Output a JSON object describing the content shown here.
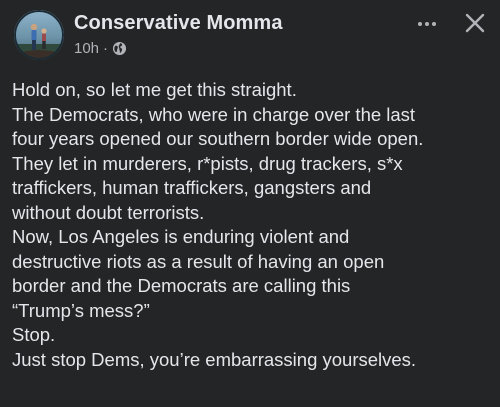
{
  "post": {
    "author": "Conservative Momma",
    "time": "10h",
    "separator": "·",
    "privacy_icon": "globe-icon",
    "more_icon": "more-horizontal-icon",
    "close_icon": "close-icon",
    "lines": [
      "Hold on, so let me get this straight.",
      "The Democrats, who were in charge over the last",
      "four years opened our southern border wide open.",
      "They let in murderers, r*pists, drug trackers, s*x",
      "traffickers, human traffickers, gangsters and",
      "without doubt terrorists.",
      "Now, Los Angeles is enduring violent and",
      "destructive riots as a result of having an open",
      "border and the Democrats are calling this",
      "“Trump’s mess?”",
      "Stop.",
      "Just stop Dems, you’re embarrassing yourselves."
    ]
  },
  "colors": {
    "background": "#242526",
    "primary_text": "#e4e6eb",
    "secondary_text": "#b0b3b8"
  }
}
